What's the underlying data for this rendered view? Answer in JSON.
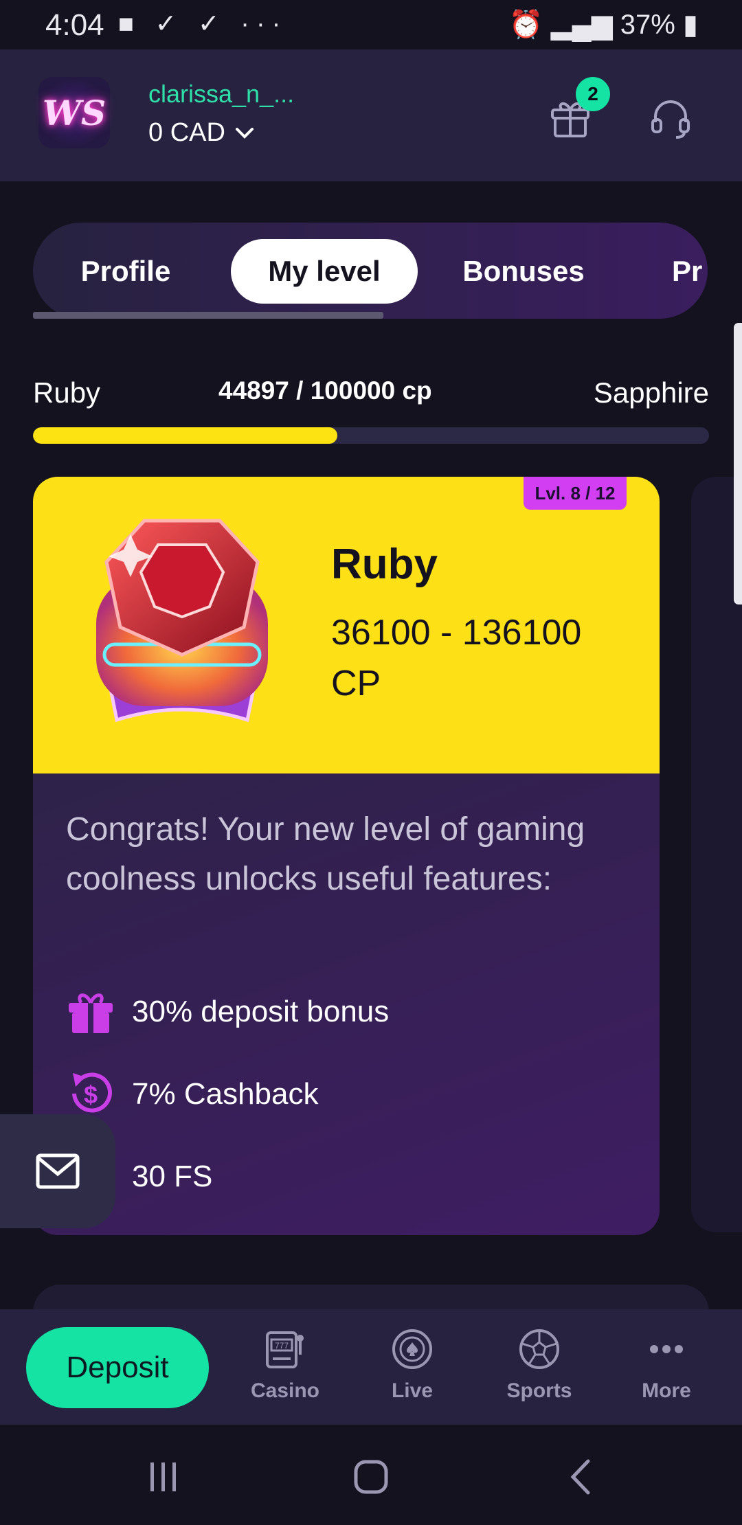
{
  "status_bar": {
    "time": "4:04",
    "left_icons": "■ ✓ ✓ ···",
    "battery": "37%"
  },
  "header": {
    "logo_text": "WS",
    "username": "clarissa_n_...",
    "balance": "0 CAD",
    "gift_badge_count": "2"
  },
  "tabs": [
    {
      "label": "Profile"
    },
    {
      "label": "My level",
      "active": true
    },
    {
      "label": "Bonuses"
    },
    {
      "label": "Pr"
    }
  ],
  "progress": {
    "current_level": "Ruby",
    "points_text": "44897 / 100000 cp",
    "next_level": "Sapphire",
    "fill_percent": 45
  },
  "level_card": {
    "badge": "Lvl. 8 / 12",
    "title": "Ruby",
    "range": "36100 - 136100 CP",
    "congrats": "Congrats! Your new level of gaming coolness unlocks useful features:",
    "features": [
      {
        "icon": "gift-icon",
        "text": "30% deposit bonus"
      },
      {
        "icon": "cashback-icon",
        "text": "7% Cashback"
      },
      {
        "icon": "free-spins-icon",
        "text": "30 FS"
      }
    ]
  },
  "bottom_nav": {
    "deposit": "Deposit",
    "items": [
      {
        "label": "Casino",
        "icon": "slot-machine-icon"
      },
      {
        "label": "Live",
        "icon": "poker-chip-icon"
      },
      {
        "label": "Sports",
        "icon": "soccer-ball-icon"
      },
      {
        "label": "More",
        "icon": "more-dots-icon"
      }
    ]
  },
  "colors": {
    "accent_green": "#14e3a4",
    "accent_yellow": "#fde015",
    "accent_pink": "#d23ff2",
    "background": "#14121f"
  }
}
